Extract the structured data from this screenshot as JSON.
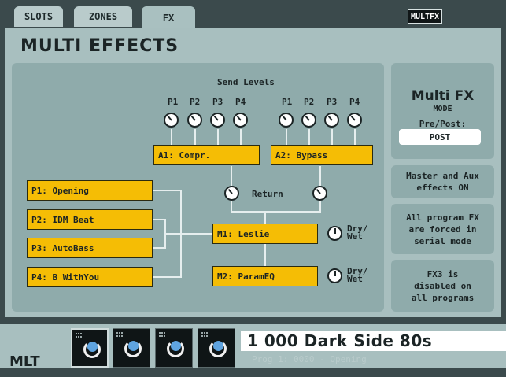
{
  "tabs": [
    {
      "label": "SLOTS"
    },
    {
      "label": "ZONES"
    },
    {
      "label": "FX"
    }
  ],
  "mode_badge": "MULTFX",
  "page_title": "MULTI EFFECTS",
  "send_levels": {
    "title": "Send Levels",
    "group_a_labels": [
      "P1",
      "P2",
      "P3",
      "P4"
    ],
    "group_b_labels": [
      "P1",
      "P2",
      "P3",
      "P4"
    ]
  },
  "aux": {
    "a1": "A1: Compr.",
    "a2": "A2: Bypass"
  },
  "return_label": "Return",
  "programs": [
    "P1: Opening",
    "P2: IDM Beat",
    "P3: AutoBass",
    "P4: B WithYou"
  ],
  "masters": {
    "m1": "M1: Leslie",
    "m2": "M2: ParamEQ",
    "drywet_label_1": "Dry/",
    "drywet_label_2": "Wet"
  },
  "mode_panel": {
    "title": "Multi FX",
    "subtitle": "MODE",
    "prepost_label": "Pre/Post:",
    "prepost_value": "POST"
  },
  "info_boxes": [
    {
      "line1": "Master and Aux",
      "line2": "effects ON",
      "line3": ""
    },
    {
      "line1": "All program FX",
      "line2": "are forced in",
      "line3": "serial mode"
    },
    {
      "line1": "FX3 is",
      "line2": "disabled on",
      "line3": "all programs"
    }
  ],
  "bottom": {
    "mlt_label": "MLT",
    "program_name": "1 000 Dark Side 80s",
    "program_sub": "Prog 1: 0000 - Opening"
  },
  "colors": {
    "slot_yellow": "#f5bd05",
    "panel_bg": "#a8bfbf",
    "routing_bg": "#8fabab",
    "dark_bg": "#3b4a4c"
  }
}
